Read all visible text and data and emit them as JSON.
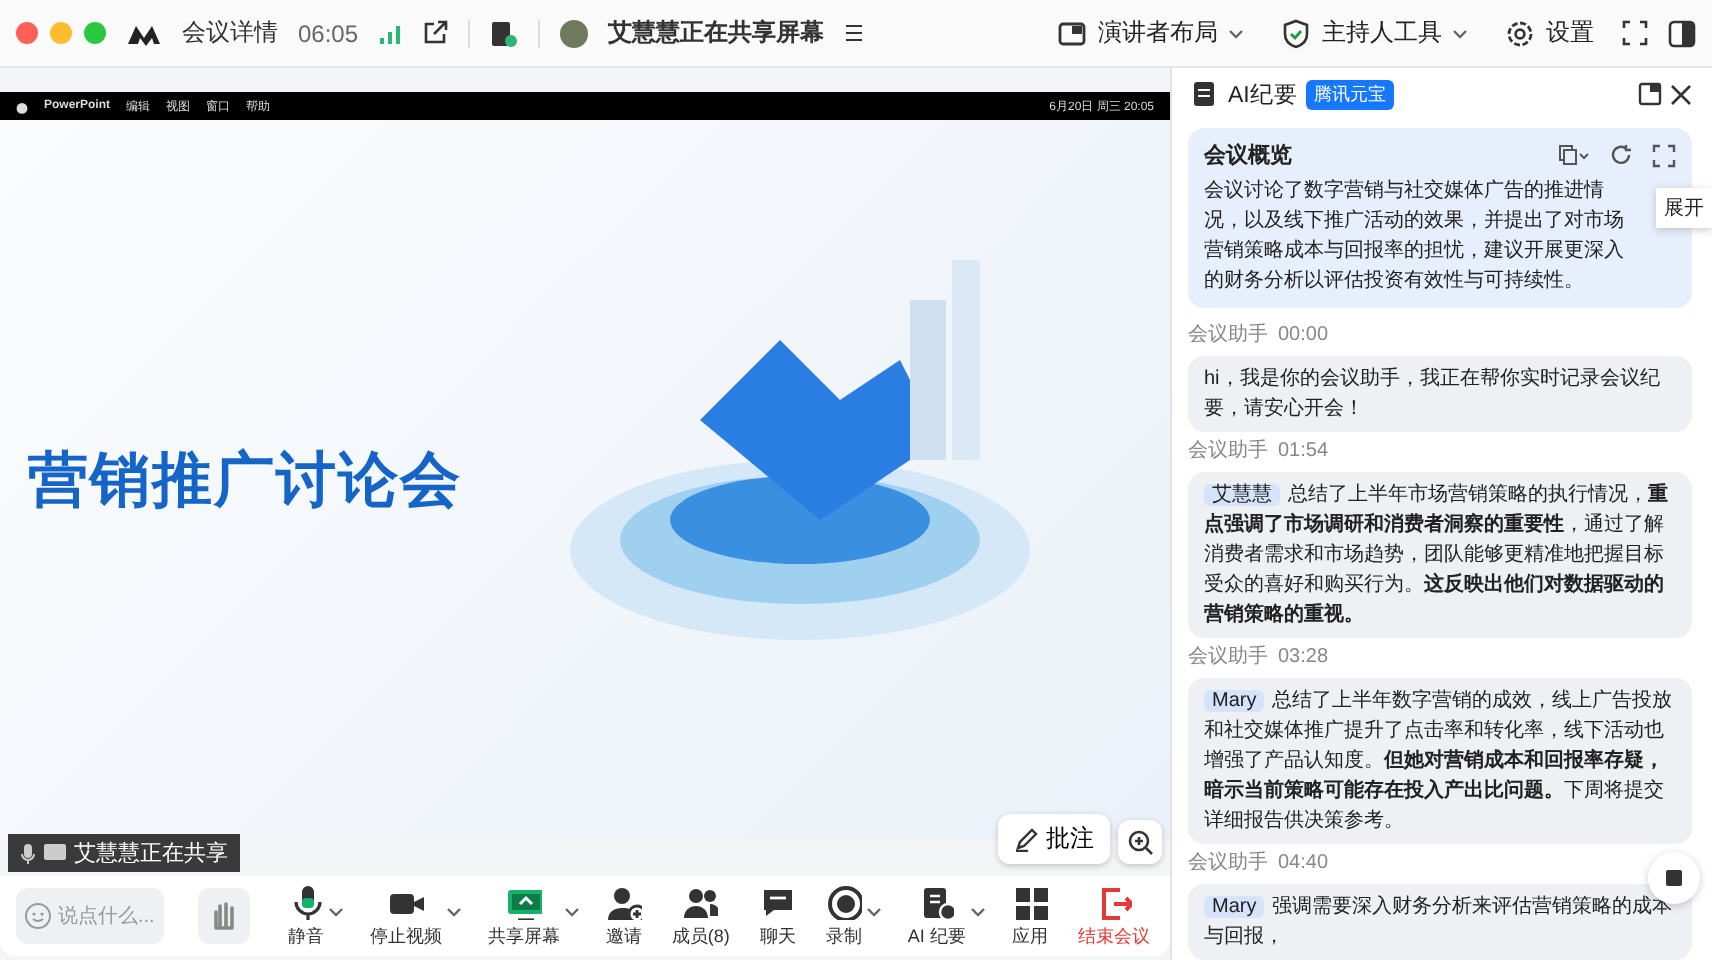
{
  "title_bar": {
    "meeting_info": "会议详情",
    "time": "06:05",
    "sharing_status": "艾慧慧正在共享屏幕"
  },
  "top_actions": [
    {
      "label": "演讲者布局",
      "kind": "layout",
      "has_menu": true
    },
    {
      "label": "主持人工具",
      "kind": "shield",
      "has_menu": true
    },
    {
      "label": "设置",
      "kind": "gear",
      "has_menu": false
    }
  ],
  "shared_screen": {
    "menu_bar": {
      "app": "PowerPoint",
      "menus": [
        "编辑",
        "视图",
        "窗口",
        "帮助"
      ],
      "clock": "6月20日 周三 20:05"
    },
    "slide_title": "营销推广讨论会",
    "sharer_label": "艾慧慧正在共享",
    "annotate_button": "批注"
  },
  "toolbar": {
    "chat_placeholder": "说点什么...",
    "buttons": [
      {
        "label": "静音",
        "kind": "mic",
        "has_menu": true,
        "danger": false
      },
      {
        "label": "停止视频",
        "kind": "camera",
        "has_menu": true,
        "danger": false
      },
      {
        "label": "共享屏幕",
        "kind": "screen",
        "has_menu": true,
        "danger": false
      },
      {
        "label": "邀请",
        "kind": "invite",
        "has_menu": false,
        "danger": false
      },
      {
        "label": "成员(8)",
        "kind": "members",
        "has_menu": false,
        "danger": false
      },
      {
        "label": "聊天",
        "kind": "chat",
        "has_menu": false,
        "danger": false
      },
      {
        "label": "录制",
        "kind": "record",
        "has_menu": true,
        "danger": false
      },
      {
        "label": "AI 纪要",
        "kind": "notes",
        "has_menu": true,
        "danger": false
      },
      {
        "label": "应用",
        "kind": "apps",
        "has_menu": false,
        "danger": false
      },
      {
        "label": "结束会议",
        "kind": "exit",
        "has_menu": false,
        "danger": true
      }
    ]
  },
  "ai_panel": {
    "title": "AI纪要",
    "badge": "腾讯元宝",
    "overview": {
      "title": "会议概览",
      "text": "会议讨论了数字营销与社交媒体广告的推进情况，以及线下推广活动的效果，并提出了对市场营销策略成本与回报率的担忧，建议开展更深入的财务分析以评估投资有效性与可持续性。",
      "tooltip": "展开"
    },
    "messages": [
      {
        "sender": "会议助手",
        "time": "00:00",
        "text": "hi，我是你的会议助手，我正在帮你实时记录会议纪要，请安心开会！"
      },
      {
        "sender": "会议助手",
        "time": "01:54",
        "speaker": "艾慧慧",
        "text": "总结了上半年市场营销策略的执行情况，**重点强调了市场调研和消费者洞察的重要性**，通过了解消费者需求和市场趋势，团队能够更精准地把握目标受众的喜好和购买行为。**这反映出他们对数据驱动的营销策略的重视。**"
      },
      {
        "sender": "会议助手",
        "time": "03:28",
        "speaker": "Mary",
        "text": "总结了上半年数字营销的成效，线上广告投放和社交媒体推广提升了点击率和转化率，线下活动也增强了产品认知度。**但她对营销成本和回报率存疑，暗示当前策略可能存在投入产出比问题。**下周将提交详细报告供决策参考。"
      },
      {
        "sender": "会议助手",
        "time": "04:40",
        "speaker": "Mary",
        "text": "强调需要深入财务分析来评估营销策略的成本与回报，"
      }
    ]
  }
}
